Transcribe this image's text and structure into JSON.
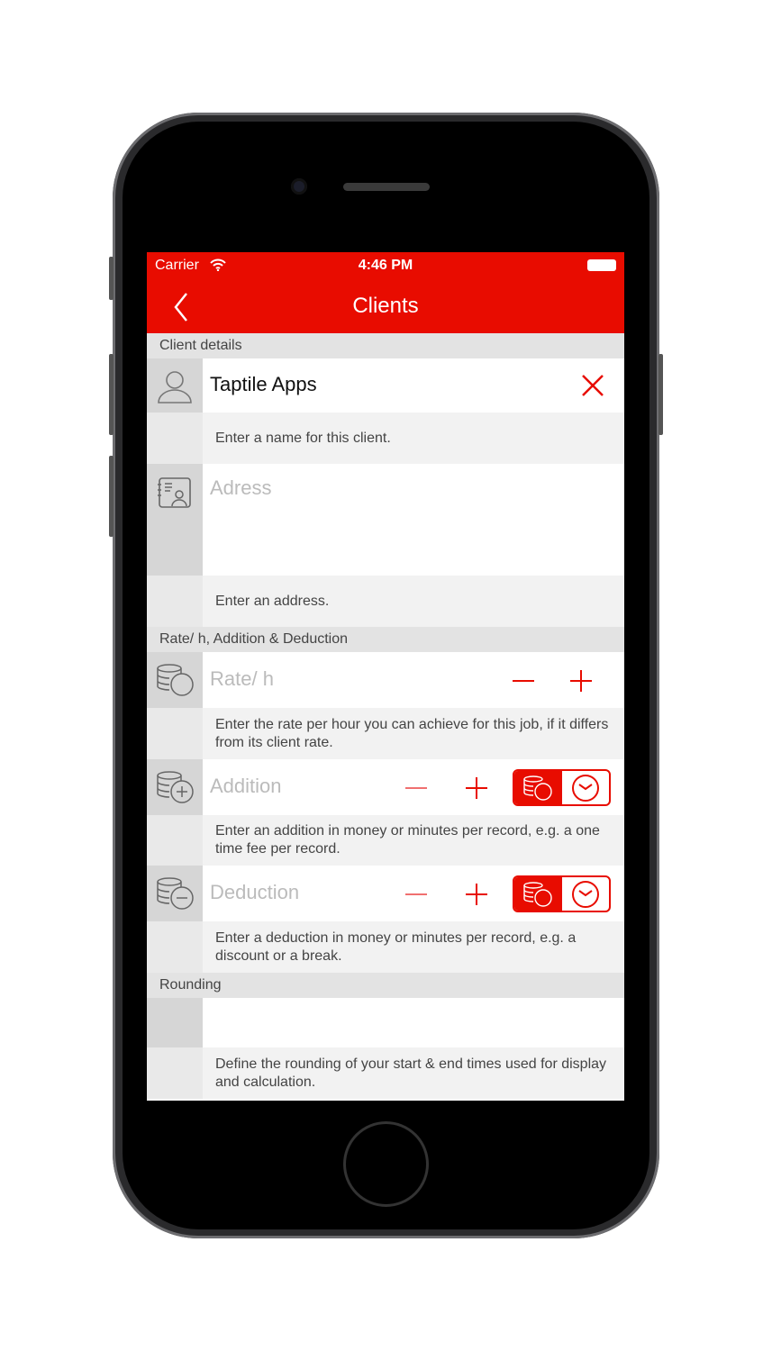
{
  "status": {
    "carrier": "Carrier",
    "time": "4:46 PM"
  },
  "nav": {
    "title": "Clients"
  },
  "sections": {
    "client_details": "Client details",
    "rate": "Rate/ h, Addition & Deduction",
    "rounding": "Rounding"
  },
  "name": {
    "value": "Taptile Apps",
    "hint": "Enter a name for this client."
  },
  "address": {
    "placeholder": "Adress",
    "hint": "Enter an address."
  },
  "rate": {
    "placeholder": "Rate/ h",
    "hint": "Enter the rate per hour you can achieve for this job, if it differs from its client rate."
  },
  "addition": {
    "placeholder": "Addition",
    "hint": "Enter an addition in money or minutes per record, e.g. a one time fee per record.",
    "mode": "money"
  },
  "deduction": {
    "placeholder": "Deduction",
    "hint": "Enter a deduction in money or minutes per record, e.g. a discount or a break.",
    "mode": "money"
  },
  "rounding": {
    "hint": "Define the rounding of your start & end times used for display and calculation."
  },
  "colors": {
    "accent": "#e80c00"
  }
}
